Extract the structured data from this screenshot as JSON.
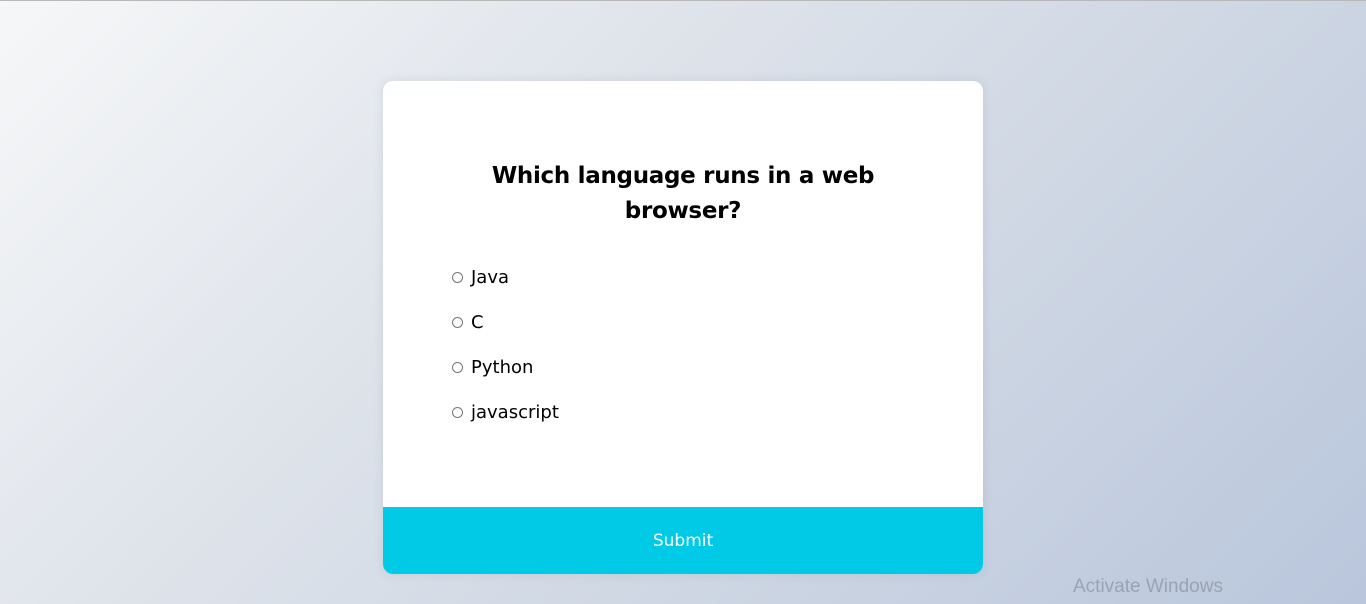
{
  "quiz": {
    "question": "Which language runs in a web browser?",
    "answers": [
      {
        "label": "Java"
      },
      {
        "label": "C"
      },
      {
        "label": "Python"
      },
      {
        "label": "javascript"
      }
    ],
    "submit_label": "Submit"
  },
  "watermark": {
    "text": "Activate Windows"
  },
  "colors": {
    "submit_background": "#00cae6",
    "card_background": "#ffffff"
  }
}
